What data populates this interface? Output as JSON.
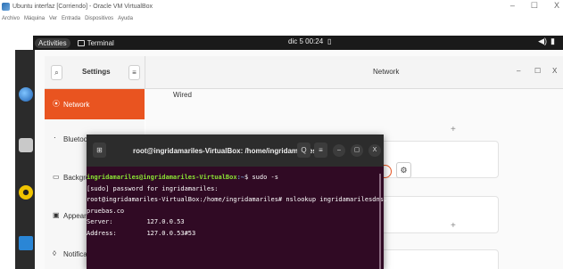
{
  "vbox": {
    "title": "Ubuntu interfaz [Corriendo] - Oracle VM VirtualBox",
    "menu": [
      "Archivo",
      "Máquina",
      "Ver",
      "Entrada",
      "Dispositivos",
      "Ayuda"
    ],
    "controls": {
      "minimize": "–",
      "restore": "☐",
      "close": "X"
    }
  },
  "topbar": {
    "activities": "Activities",
    "app": "Terminal",
    "clock": "dic 5 00:24",
    "bell": "▯",
    "sound": "◀)",
    "battery": "▮"
  },
  "settings": {
    "title": "Settings",
    "search_icon": "search-icon",
    "menu_icon": "menu-icon",
    "page_title": "Network",
    "window": {
      "minimize": "–",
      "maximize": "☐",
      "close": "X"
    },
    "sidebar": [
      {
        "label": "Network",
        "icon": "⦿",
        "active": true
      },
      {
        "label": "Bluetooth",
        "icon": "᛫"
      },
      {
        "label": "Background",
        "icon": "▭"
      },
      {
        "label": "Appearance",
        "icon": "▣"
      },
      {
        "label": "Notifications",
        "icon": "◊"
      }
    ],
    "wired_label": "Wired",
    "plus": "+",
    "toggle_on": true,
    "gear": "⚙",
    "accent": "#e95420"
  },
  "terminal": {
    "title": "root@ingridamariles-VirtualBox: /home/ingridamariles",
    "buttons": {
      "new_tab": "⊞",
      "search": "Q",
      "menu": "≡",
      "minimize": "–",
      "maximize": "▢",
      "close": "X"
    },
    "lines": [
      {
        "user": "ingridamariles@ingridamariles-VirtualBox",
        "path": ":~",
        "cmd": "$ sudo -s"
      },
      {
        "text": "[sudo] password for ingridamariles:"
      },
      {
        "text": "root@ingridamariles-VirtualBox:/home/ingridamariles# nslookup ingridamarilesdns."
      },
      {
        "text": "pruebas.co"
      },
      {
        "text": "Server:\t\t127.0.0.53"
      },
      {
        "text": "Address:\t127.0.0.53#53"
      }
    ],
    "bg": "#300a24"
  }
}
